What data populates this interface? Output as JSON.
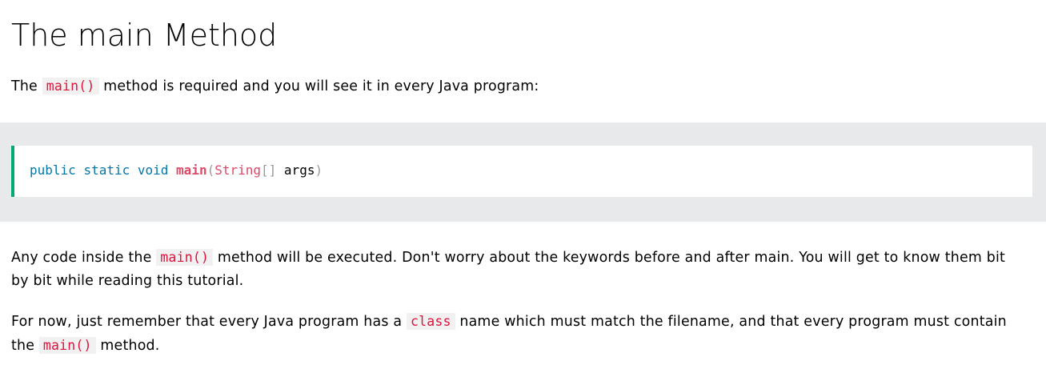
{
  "title": "The main Method",
  "para1": {
    "before": "The ",
    "code": "main()",
    "after": " method is required and you will see it in every Java program:"
  },
  "example": {
    "kw_public": "public",
    "kw_static": "static",
    "kw_void": "void",
    "fn_name": "main",
    "paren_open": "(",
    "type_string": "String",
    "brackets": "[]",
    "arg_name": "args",
    "paren_close": ")"
  },
  "para2": {
    "before": "Any code inside the ",
    "code": "main()",
    "after": " method will be executed. Don't worry about the keywords before and after main. You will get to know them bit by bit while reading this tutorial."
  },
  "para3": {
    "before": "For now, just remember that every Java program has a ",
    "code1": "class",
    "middle": " name which must match the filename, and that every program must contain the ",
    "code2": "main()",
    "after": " method."
  },
  "colors": {
    "accent_green": "#04aa6d",
    "code_red": "#dc143c",
    "band_gray": "#e7e9eb"
  }
}
